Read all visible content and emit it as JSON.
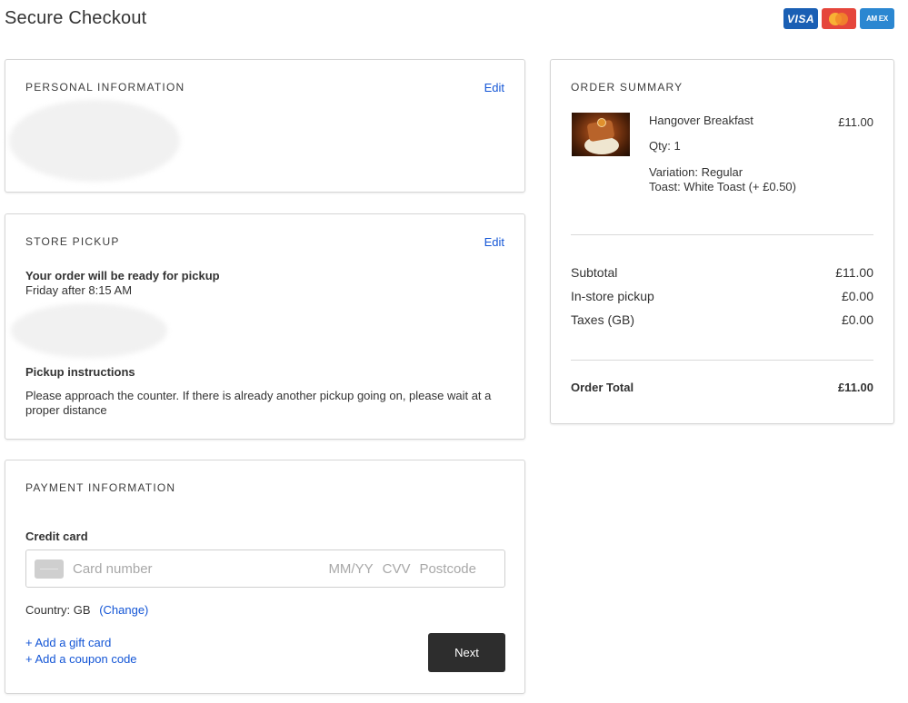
{
  "header": {
    "title": "Secure Checkout",
    "card_logos": [
      {
        "name": "visa-logo",
        "text": "VISA",
        "color": "#1a5fb4"
      },
      {
        "name": "mastercard-logo",
        "text": "",
        "color": "#e5463b"
      },
      {
        "name": "amex-logo",
        "text": "AM EX",
        "color": "#2b87d1"
      }
    ]
  },
  "personal": {
    "heading": "PERSONAL INFORMATION",
    "edit_label": "Edit"
  },
  "pickup": {
    "heading": "STORE PICKUP",
    "edit_label": "Edit",
    "ready_label": "Your order will be ready for pickup",
    "ready_time": "Friday after 8:15 AM",
    "instructions_label": "Pickup instructions",
    "instructions_text": "Please approach the counter. If there is already another pickup going on, please wait at a proper distance"
  },
  "payment": {
    "heading": "PAYMENT INFORMATION",
    "credit_card_label": "Credit card",
    "card_number_placeholder": "Card number",
    "expiry_placeholder": "MM/YY",
    "cvv_placeholder": "CVV",
    "postcode_placeholder": "Postcode",
    "country_label": "Country:",
    "country_value": "GB",
    "change_label": "(Change)",
    "gift_card_link": "+ Add a gift card",
    "coupon_link": "+ Add a coupon code",
    "next_label": "Next"
  },
  "summary": {
    "heading": "ORDER SUMMARY",
    "item": {
      "name": "Hangover Breakfast",
      "price": "£11.00",
      "qty": "Qty: 1",
      "variation": "Variation: Regular",
      "modifier": "Toast: White Toast (+ £0.50)"
    },
    "subtotal_label": "Subtotal",
    "subtotal_value": "£11.00",
    "pickup_label": "In-store pickup",
    "pickup_value": "£0.00",
    "taxes_label": "Taxes (GB)",
    "taxes_value": "£0.00",
    "total_label": "Order Total",
    "total_value": "£11.00"
  },
  "colors": {
    "link": "#1456d6",
    "button_bg": "#2d2d2d",
    "border": "#d6d6d6"
  }
}
